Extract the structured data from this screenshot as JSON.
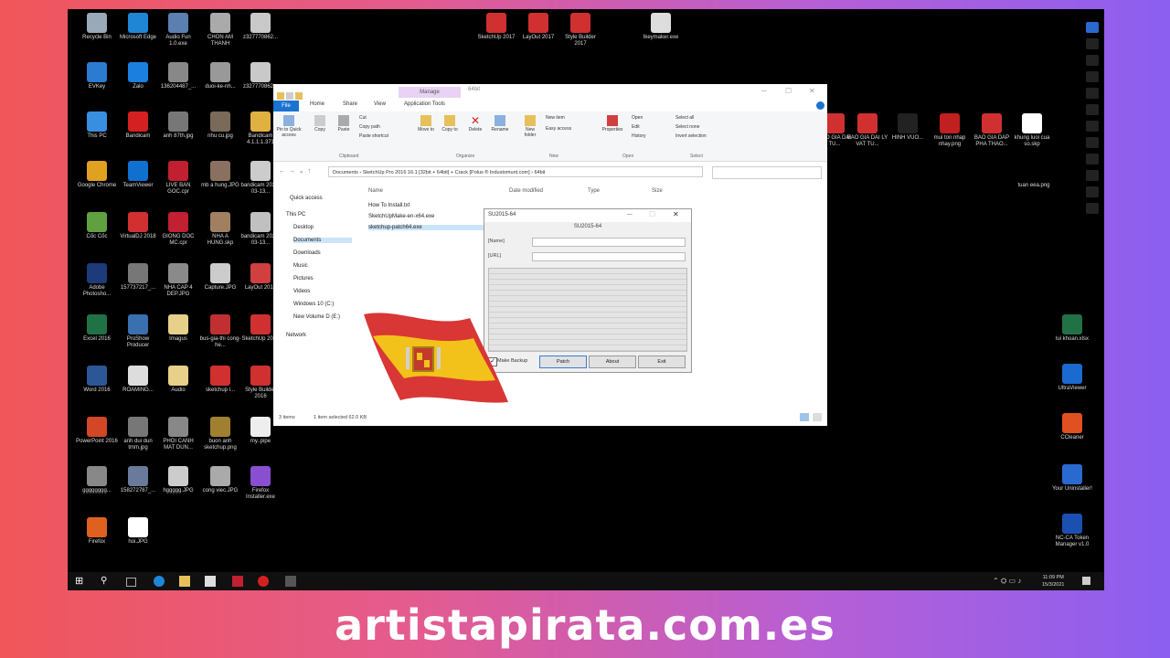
{
  "desktop_icons": [
    {
      "label": "Recycle Bin",
      "color": "#9aa9b8"
    },
    {
      "label": "Microsoft Edge",
      "color": "#1f86d6"
    },
    {
      "label": "Audio Fun 1.0.exe",
      "color": "#5b7fb0"
    },
    {
      "label": "CHON AM THANH",
      "color": "#aaaaaa"
    },
    {
      "label": "z327770862...",
      "color": "#c9c9c9"
    },
    {
      "label": "EVKey",
      "color": "#2b7bd0"
    },
    {
      "label": "Zalo",
      "color": "#1b7fe0"
    },
    {
      "label": "136204487_...",
      "color": "#888888"
    },
    {
      "label": "duoi-ke-nh...",
      "color": "#999999"
    },
    {
      "label": "z327770862...",
      "color": "#c9c9c9"
    },
    {
      "label": "This PC",
      "color": "#3a8ee0"
    },
    {
      "label": "Bandicam",
      "color": "#d42020"
    },
    {
      "label": "anh 87th.jpg",
      "color": "#777777"
    },
    {
      "label": "nhu cu.jpg",
      "color": "#7a6a5a"
    },
    {
      "label": "Bandicam 4.1.1.1.371",
      "color": "#e0b040"
    },
    {
      "label": "Google Chrome",
      "color": "#e0a020"
    },
    {
      "label": "TeamViewer",
      "color": "#1070d0"
    },
    {
      "label": "LIVE BAN GOC.cpr",
      "color": "#c02030"
    },
    {
      "label": "mb a hung.JPG",
      "color": "#8a7060"
    },
    {
      "label": "bandicam 2021-03-13...",
      "color": "#cccccc"
    },
    {
      "label": "Cốc Cốc",
      "color": "#60a040"
    },
    {
      "label": "VirtualDJ 2018",
      "color": "#d03030"
    },
    {
      "label": "GIONG DOC MC.cpr",
      "color": "#c02030"
    },
    {
      "label": "NHA A HUNG.skp",
      "color": "#a08060"
    },
    {
      "label": "bandicam 2021-03-13...",
      "color": "#c0c0c0"
    },
    {
      "label": "Adobe Photosho...",
      "color": "#1c3b78"
    },
    {
      "label": "157737217_...",
      "color": "#777777"
    },
    {
      "label": "NHA CAP 4 DEP.JPG",
      "color": "#8a8a8a"
    },
    {
      "label": "Capture.JPG",
      "color": "#cccccc"
    },
    {
      "label": "LayOut 2018",
      "color": "#d04040"
    },
    {
      "label": "Excel 2016",
      "color": "#207245"
    },
    {
      "label": "ProShow Producer",
      "color": "#3a6fb0"
    },
    {
      "label": "Imagus",
      "color": "#e6d08a"
    },
    {
      "label": "bus-gia-thi cong-he...",
      "color": "#c03030"
    },
    {
      "label": "SketchUp 2016",
      "color": "#d03030"
    },
    {
      "label": "Word 2016",
      "color": "#2b5797"
    },
    {
      "label": "ROAMING...",
      "color": "#dddddd"
    },
    {
      "label": "Audio",
      "color": "#e6d08a"
    },
    {
      "label": "sketchup l...",
      "color": "#d03030"
    },
    {
      "label": "Style Builder 2016",
      "color": "#d03030"
    },
    {
      "label": "PowerPoint 2016",
      "color": "#d24726"
    },
    {
      "label": "anh dui dun tmm.jpg",
      "color": "#777777"
    },
    {
      "label": "PHOI CANH MAT DUN...",
      "color": "#888888"
    },
    {
      "label": "buon anh sketchup.png",
      "color": "#a08030"
    },
    {
      "label": "my..pipe",
      "color": "#eeeeee"
    },
    {
      "label": "gggggggg...",
      "color": "#888888"
    },
    {
      "label": "158272787_...",
      "color": "#6a7a9a"
    },
    {
      "label": "hggggg.JPG",
      "color": "#cccccc"
    },
    {
      "label": "cong viec.JPG",
      "color": "#aaaaaa"
    },
    {
      "label": "Firefox Installer.exe",
      "color": "#8a4fd0"
    },
    {
      "label": "Firefox",
      "color": "#e06020"
    },
    {
      "label": "hoi.JPG",
      "color": "#ffffff"
    }
  ],
  "top_icons": [
    {
      "label": "SketchUp 2017",
      "color": "#d03030"
    },
    {
      "label": "LayOut 2017",
      "color": "#d03030"
    },
    {
      "label": "Style Builder 2017",
      "color": "#d03030"
    },
    {
      "label": "Ikeymaker.exe",
      "color": "#dddddd"
    }
  ],
  "right_icons": [
    {
      "label": "BAO GIA DAI TU...",
      "color": "#d03030"
    },
    {
      "label": "BAO GIA DAI LY VAT TU...",
      "color": "#d03030"
    },
    {
      "label": "HINH VUO...",
      "color": "#222222"
    },
    {
      "label": "mui ton nhap nhay.png",
      "color": "#c02020"
    },
    {
      "label": "BAO GIA DAP PHA THAO...",
      "color": "#d03030"
    },
    {
      "label": "khung luoi cua so.skp",
      "color": "#ffffff"
    },
    {
      "label": "tuan eea.png",
      "color": "#000000"
    },
    {
      "label": "lui khoan.xlsx",
      "color": "#207245"
    },
    {
      "label": "UltraViewer",
      "color": "#1a6ad0"
    },
    {
      "label": "CCleaner",
      "color": "#e05020"
    },
    {
      "label": "Your Uninstaller!",
      "color": "#2a6ad0"
    },
    {
      "label": "NC-CA Token Manager v1.0",
      "color": "#1a50b0"
    }
  ],
  "explorer": {
    "tab_file": "File",
    "tab_home": "Home",
    "tab_share": "Share",
    "tab_view": "View",
    "context_tab": "Manage",
    "context_sub": "Application Tools",
    "title_folder": "64bit",
    "ribbon": {
      "pin": "Pin to Quick access",
      "copy": "Copy",
      "paste": "Paste",
      "cut": "Cut",
      "copy_path": "Copy path",
      "paste_shortcut": "Paste shortcut",
      "move_to": "Move to",
      "copy_to": "Copy to",
      "delete": "Delete",
      "rename": "Rename",
      "new_folder": "New folder",
      "new_item": "New item",
      "easy_access": "Easy access",
      "properties": "Properties",
      "open": "Open",
      "edit": "Edit",
      "history": "History",
      "select_all": "Select all",
      "select_none": "Select none",
      "invert_selection": "Invert selection",
      "grp_clipboard": "Clipboard",
      "grp_organize": "Organize",
      "grp_new": "New",
      "grp_open": "Open",
      "grp_select": "Select"
    },
    "address": "Documents  ›  SketchUp Pro 2016 16.1 [32bit + 64bit] + Crack [Polus ® Industomunt.com]  ›  64bit",
    "nav": [
      "Quick access",
      "This PC",
      "Desktop",
      "Documents",
      "Downloads",
      "Music",
      "Pictures",
      "Videos",
      "Windows 10 (C:)",
      "New Volume D (E:)",
      "Network"
    ],
    "columns": {
      "name": "Name",
      "date": "Date modified",
      "type": "Type",
      "size": "Size"
    },
    "files": [
      "How To Install.txt",
      "SketchUpMake-en-x64.exe",
      "sketchup-patch64.exe"
    ],
    "status_items": "3 items",
    "status_selected": "1 item selected  62.0 KB"
  },
  "patch": {
    "title": "SU2015-64",
    "header": "SU2015-64",
    "label_name": "[Name]",
    "label_url": "[URL]",
    "backup": "Make Backup",
    "btn_patch": "Patch",
    "btn_about": "About",
    "btn_exit": "Exit"
  },
  "tray": {
    "time": "11:09 PM",
    "date": "15/3/2021"
  },
  "watermark": "artistapirata.com.es"
}
